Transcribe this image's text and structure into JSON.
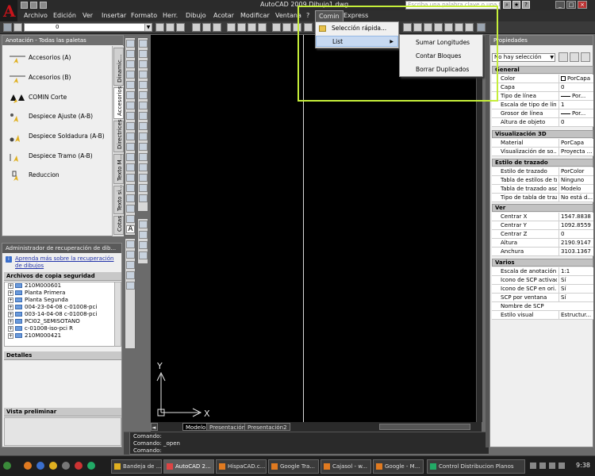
{
  "window": {
    "title": "AutoCAD 2009 Dibujo1.dwg",
    "search_placeholder": "Escriba una palabra clave o una frase"
  },
  "menubar": {
    "items": [
      "Archivo",
      "Edición",
      "Ver",
      "Insertar",
      "Formato",
      "Herr.",
      "Dibujo",
      "Acotar",
      "Modificar",
      "Ventana",
      "?",
      "Comin",
      "Express"
    ]
  },
  "toolbar": {
    "layer_value": "0"
  },
  "dropdown": {
    "items": [
      {
        "label": "Selección rápida..."
      },
      {
        "label": "List"
      }
    ],
    "submenu": [
      "Sumar Longitudes",
      "Contar Bloques",
      "Borrar Duplicados"
    ]
  },
  "palette": {
    "title": "Anotación - Todas las paletas",
    "items": [
      "Accesorios (A)",
      "Accesorios (B)",
      "COMIN Corte",
      "Despiece Ajuste (A-B)",
      "Despiece Soldadura (A-B)",
      "Despiece Tramo (A-B)",
      "Reduccion"
    ],
    "tabs": [
      "Dinamic...",
      "Accesorios",
      "Directrices",
      "Texto M...",
      "Texto si...",
      "Cotas"
    ]
  },
  "recovery": {
    "title": "Administrador de recuperación de dib...",
    "link": "Aprenda más sobre la recuperación de dibujos",
    "backup_header": "Archivos de copia seguridad",
    "files": [
      "210M000601",
      "Planta Primera",
      "Planta Segunda",
      "004-23-04-08 c-01008-pci",
      "003-14-04-08 c-01008-pci",
      "PCI02_SEMISOTANO",
      "c-01008-iso-pci R",
      "210M000421"
    ],
    "details_header": "Detalles",
    "preview_header": "Vista preliminar"
  },
  "layout_tabs": [
    "Modelo",
    "Presentación1",
    "Presentación2"
  ],
  "command": {
    "lines": [
      "Comando:",
      "Comando: _open",
      "Comando:"
    ]
  },
  "axes": {
    "y": "Y",
    "x": "X"
  },
  "properties": {
    "title": "Propiedades",
    "selection": "No hay selección",
    "groups": [
      {
        "name": "General",
        "rows": [
          {
            "k": "Color",
            "v": "PorCapa"
          },
          {
            "k": "Capa",
            "v": "0"
          },
          {
            "k": "Tipo de línea",
            "v": "Por..."
          },
          {
            "k": "Escala de tipo de línea",
            "v": "1"
          },
          {
            "k": "Grosor de línea",
            "v": "Por..."
          },
          {
            "k": "Altura de objeto",
            "v": "0"
          }
        ]
      },
      {
        "name": "Visualización 3D",
        "rows": [
          {
            "k": "Material",
            "v": "PorCapa"
          },
          {
            "k": "Visualización de so...",
            "v": "Proyecta ..."
          }
        ]
      },
      {
        "name": "Estilo de trazado",
        "rows": [
          {
            "k": "Estilo de trazado",
            "v": "PorColor"
          },
          {
            "k": "Tabla de estilos de tr...",
            "v": "Ninguno"
          },
          {
            "k": "Tabla de trazado aso...",
            "v": "Modelo"
          },
          {
            "k": "Tipo de tabla de traz...",
            "v": "No está d..."
          }
        ]
      },
      {
        "name": "Ver",
        "rows": [
          {
            "k": "Centrar X",
            "v": "1547.8838"
          },
          {
            "k": "Centrar Y",
            "v": "1092.8559"
          },
          {
            "k": "Centrar Z",
            "v": "0"
          },
          {
            "k": "Altura",
            "v": "2190.9147"
          },
          {
            "k": "Anchura",
            "v": "3103.1367"
          }
        ]
      },
      {
        "name": "Varios",
        "rows": [
          {
            "k": "Escala de anotación",
            "v": "1:1"
          },
          {
            "k": "Icono de SCP activado",
            "v": "Sí"
          },
          {
            "k": "Icono de SCP en ori...",
            "v": "Sí"
          },
          {
            "k": "SCP por ventana",
            "v": "Sí"
          },
          {
            "k": "Nombre de SCP",
            "v": ""
          },
          {
            "k": "Estilo visual",
            "v": "Estructur..."
          }
        ]
      }
    ]
  },
  "taskbar": {
    "buttons": [
      "Bandeja de ...",
      "AutoCAD 2...",
      "HispaCAD.c...",
      "Google Tra...",
      "Cajasol - w...",
      "Google - M...",
      "Control Distribucion Planos"
    ],
    "clock": "9:38"
  },
  "colors": {
    "accent_highlight": "#c5ee3a",
    "menu_hover": "#c7d9f1",
    "drawing_bg": "#000000"
  }
}
